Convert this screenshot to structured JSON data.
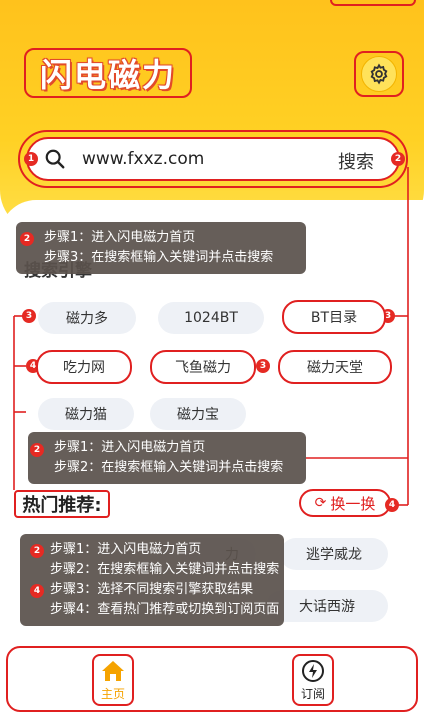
{
  "app": {
    "title": "闪电磁力"
  },
  "search": {
    "url": "www.fxxz.com",
    "button_label": "搜索"
  },
  "section": {
    "engines_label": "搜索引擎"
  },
  "engines": {
    "row1": [
      "磁力多",
      "1024BT",
      "BT目录"
    ],
    "row2": [
      "吃力网",
      "飞鱼磁力",
      "磁力天堂"
    ],
    "row3": [
      "磁力猫",
      "磁力宝"
    ]
  },
  "hot": {
    "title": "热门推荐:",
    "refresh_label": "换一换",
    "items": [
      "逃学威龙",
      "大话西游",
      "力"
    ]
  },
  "tooltips": {
    "first": [
      "步骤1：进入闪电磁力首页",
      "步骤3：在搜索框输入关键词并点击搜索"
    ],
    "second": [
      "步骤1：进入闪电磁力首页",
      "步骤2：在搜索框输入关键词并点击搜索"
    ],
    "third": [
      "步骤1：进入闪电磁力首页",
      "步骤2：在搜索框输入关键词并点击搜索",
      "步骤3：选择不同搜索引擎获取结果",
      "步骤4：查看热门推荐或切换到订阅页面"
    ]
  },
  "badges": {
    "b1": "1",
    "b2": "2",
    "b3": "3",
    "b4": "4"
  },
  "tabs": {
    "home": "主页",
    "subscribe": "订阅"
  },
  "colors": {
    "accent_red": "#e02020",
    "brand_yellow": "#ffc21c",
    "home_icon": "#f5a300"
  }
}
